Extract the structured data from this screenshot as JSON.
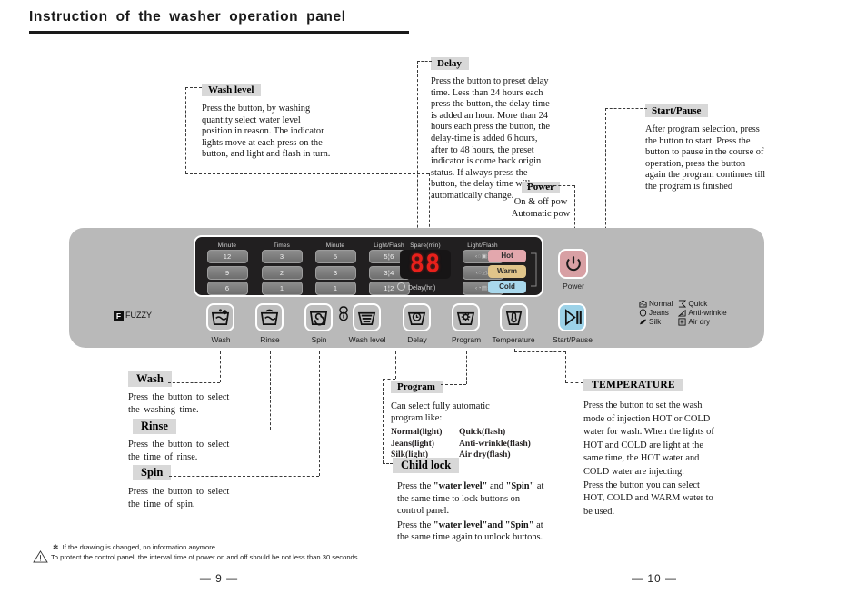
{
  "title": "Instruction of the washer operation panel",
  "callouts": {
    "wash_level": {
      "label": "Wash level",
      "text": "Press the button, by washing quantity select water level position in reason. The indicator lights move at each press on the button, and light and flash in turn."
    },
    "delay": {
      "label": "Delay",
      "text": "Press the button to preset delay time. Less than 24 hours each press the button, the delay-time is added an hour. More than 24 hours each press the button, the delay-time is added 6 hours, after to 48 hours, the preset indicator is come back origin status. If always press the button, the delay time will automatically change."
    },
    "power": {
      "label": "Power",
      "line1": "On & off pow",
      "line2": "Automatic pow"
    },
    "start_pause": {
      "label": "Start/Pause",
      "text": "After program selection, press the button to start. Press the button to pause in the course of operation, press the button again the program continues till the program is finished"
    },
    "wash": {
      "label": "Wash",
      "line1": "Press the button to select",
      "line2": "the washing time."
    },
    "rinse": {
      "label": "Rinse",
      "line1": "Press the button to select",
      "line2": "the time of rinse."
    },
    "spin": {
      "label": "Spin",
      "line1": "Press the button to select",
      "line2": "the time of spin."
    },
    "program": {
      "label": "Program",
      "line1": "Can select fully automatic",
      "line2": " program like:",
      "options": [
        [
          "Normal(light)",
          "Quick(flash)"
        ],
        [
          "Jeans(light)",
          "Anti-wrinkle(flash)"
        ],
        [
          "Silk(light)",
          "Air dry(flash)"
        ]
      ]
    },
    "child_lock": {
      "label": "Child lock",
      "p1_a": "Press the ",
      "p1_b": "\"water level\"",
      "p1_c": " and ",
      "p1_d": "\"Spin\"",
      "p1_e": " at the same time to lock buttons on control panel.",
      "p2_a": "Press the ",
      "p2_b": "\"water level\"",
      "p2_c": "and ",
      "p2_d": "\"Spin\"",
      "p2_e": " at the same time again to unlock buttons."
    },
    "temperature": {
      "label": "TEMPERATURE",
      "text": "Press the button to set the wash mode of injection HOT or COLD water  for wash. When the lights of HOT and COLD are light at the same time, the HOT water and COLD water are  injecting.",
      "text2": "Press the button you can select HOT, COLD and WARM water to be used."
    }
  },
  "panel": {
    "fuzzy_badge": "F",
    "fuzzy_label": "FUZZY",
    "display": {
      "columns": [
        {
          "header": "Minute",
          "values": [
            "12",
            "9",
            "6"
          ]
        },
        {
          "header": "Times",
          "values": [
            "3",
            "2",
            "1"
          ]
        },
        {
          "header": "Minute",
          "values": [
            "5",
            "3",
            "1"
          ]
        },
        {
          "header": "Light/Flash",
          "values": [
            "5¦6",
            "3¦4",
            "1¦2"
          ]
        }
      ],
      "spare_header": "Spare(min)",
      "segment_value": "88",
      "delay_led_label": "Delay(hr.)",
      "right_header": "Light/Flash",
      "program_indicators": [
        "‹◌▣›",
        "‹◌◿›",
        "‹◔▤›"
      ],
      "temperatures": [
        {
          "label": "Hot",
          "color": "#e3a7ad"
        },
        {
          "label": "Warm",
          "color": "#e0c48a"
        },
        {
          "label": "Cold",
          "color": "#a9d8ec"
        }
      ]
    },
    "buttons": [
      {
        "name": "wash",
        "label": "Wash",
        "icon": "wash-basket-icon"
      },
      {
        "name": "rinse",
        "label": "Rinse",
        "icon": "rinse-basket-icon"
      },
      {
        "name": "spin",
        "label": "Spin",
        "icon": "spin-basket-icon"
      },
      {
        "name": "wash-level",
        "label": "Wash level",
        "icon": "water-level-icon"
      },
      {
        "name": "delay",
        "label": "Delay",
        "icon": "clock-basket-icon"
      },
      {
        "name": "program",
        "label": "Program",
        "icon": "gear-basket-icon"
      },
      {
        "name": "temperature",
        "label": "Temperature",
        "icon": "thermometer-basket-icon"
      },
      {
        "name": "start-pause",
        "label": "Start/Pause",
        "icon": "play-pause-icon"
      }
    ],
    "power_button_label": "Power",
    "legend": [
      {
        "label": "Normal",
        "icon": "normal-icon"
      },
      {
        "label": "Quick",
        "icon": "quick-icon"
      },
      {
        "label": "Jeans",
        "icon": "jeans-icon"
      },
      {
        "label": "Anti-wrinkle",
        "icon": "anti-wrinkle-icon"
      },
      {
        "label": "Silk",
        "icon": "silk-icon"
      },
      {
        "label": "Air dry",
        "icon": "air-dry-icon"
      }
    ]
  },
  "footer": {
    "note_star": "✻",
    "note_line1": "If the drawing is changed, no information anymore.",
    "note_line2": "To protect the control panel, the interval time of power on and off should be not less than 30 seconds.",
    "page_left": "— 9 —",
    "page_right": "— 10 —"
  }
}
